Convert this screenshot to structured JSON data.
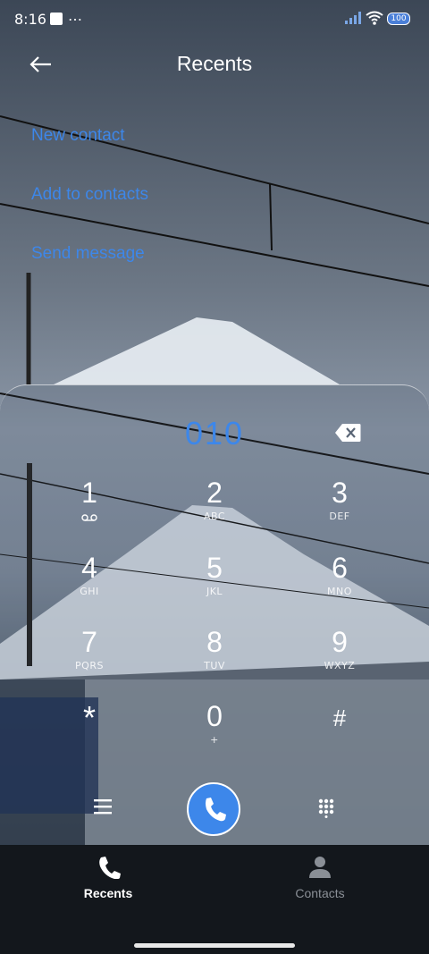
{
  "status": {
    "time": "8:16",
    "dots": "…",
    "battery": "100"
  },
  "header": {
    "title": "Recents"
  },
  "actions": [
    "New contact",
    "Add to contacts",
    "Send message"
  ],
  "dial": {
    "number": "010"
  },
  "keys": [
    {
      "digit": "1",
      "letters": ""
    },
    {
      "digit": "2",
      "letters": "ABC"
    },
    {
      "digit": "3",
      "letters": "DEF"
    },
    {
      "digit": "4",
      "letters": "GHI"
    },
    {
      "digit": "5",
      "letters": "JKL"
    },
    {
      "digit": "6",
      "letters": "MNO"
    },
    {
      "digit": "7",
      "letters": "PQRS"
    },
    {
      "digit": "8",
      "letters": "TUV"
    },
    {
      "digit": "9",
      "letters": "WXYZ"
    },
    {
      "digit": "*",
      "letters": ""
    },
    {
      "digit": "0",
      "letters": "+"
    },
    {
      "digit": "#",
      "letters": ""
    }
  ],
  "nav": {
    "recents": "Recents",
    "contacts": "Contacts"
  },
  "colors": {
    "accent": "#3d87ea",
    "nav_bg": "#13171c"
  },
  "icons": [
    "back-arrow-icon",
    "voicemail-icon",
    "backspace-icon",
    "menu-icon",
    "phone-icon",
    "dialpad-icon",
    "contacts-icon"
  ]
}
